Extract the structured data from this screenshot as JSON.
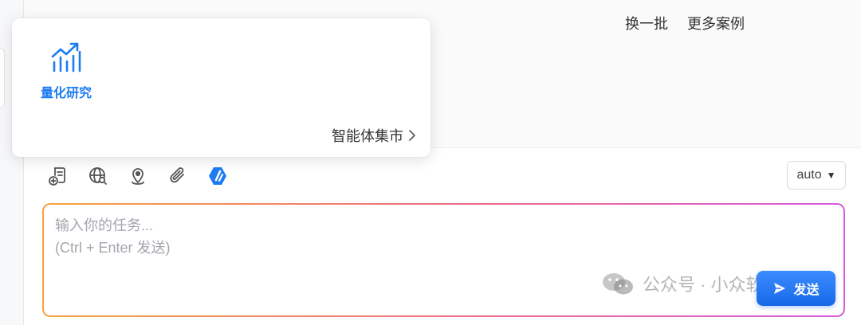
{
  "header": {
    "links": [
      "换一批",
      "更多案例"
    ]
  },
  "popover": {
    "agents": [
      {
        "label": "量化研究",
        "icon": "trending-chart-icon"
      }
    ],
    "market_link": "智能体集市"
  },
  "toolbar": {
    "tools": [
      {
        "name": "add-document-icon"
      },
      {
        "name": "web-search-icon"
      },
      {
        "name": "location-icon"
      },
      {
        "name": "attachment-icon"
      },
      {
        "name": "blue-app-icon"
      }
    ]
  },
  "model_select": {
    "value": "auto"
  },
  "input": {
    "placeholder": "输入你的任务...\n(Ctrl + Enter 发送)",
    "value": ""
  },
  "send_button": {
    "label": "发送"
  },
  "watermark": {
    "text": "公众号 · 小众软件"
  },
  "colors": {
    "accent": "#1d7cf2",
    "gradient_start": "#f6a33c",
    "gradient_end": "#d45ce0"
  }
}
